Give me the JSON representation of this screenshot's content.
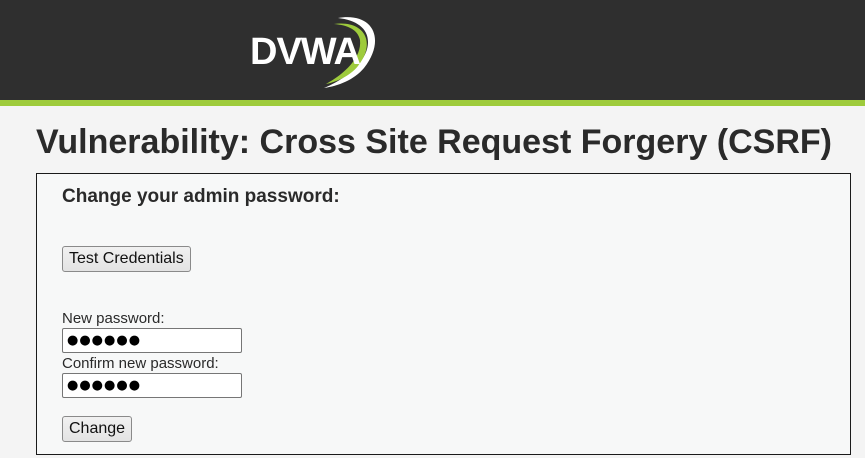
{
  "header": {
    "logo_text": "DVWA",
    "colors": {
      "background": "#2f2f2f",
      "accent": "#9ecb3c"
    }
  },
  "page": {
    "title": "Vulnerability: Cross Site Request Forgery (CSRF)"
  },
  "form": {
    "heading": "Change your admin password:",
    "test_credentials_label": "Test Credentials",
    "new_password_label": "New password:",
    "new_password_value": "●●●●●●",
    "confirm_password_label": "Confirm new password:",
    "confirm_password_value": "●●●●●●",
    "submit_label": "Change"
  }
}
